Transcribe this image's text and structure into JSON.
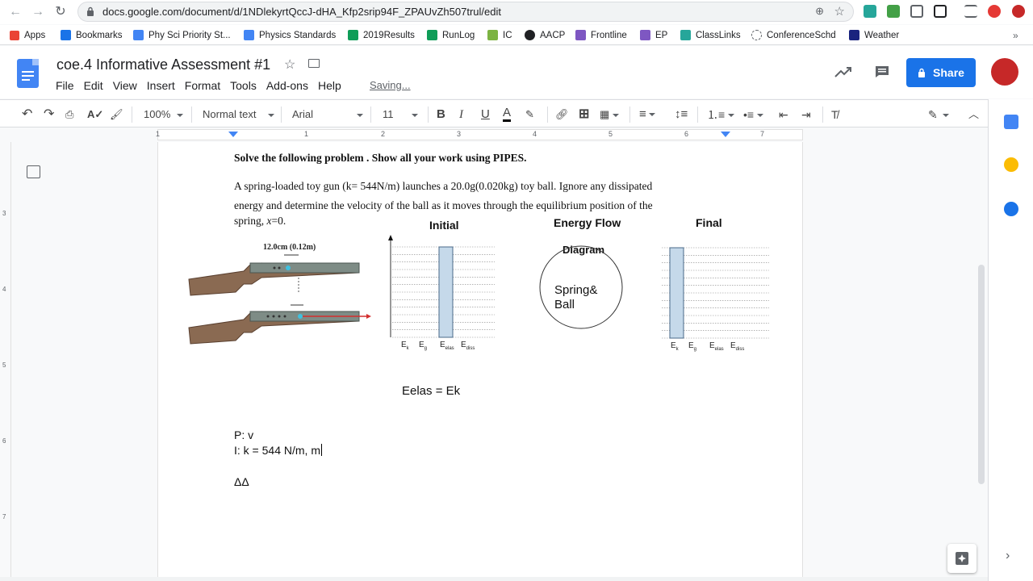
{
  "browser": {
    "url": "docs.google.com/document/d/1NDlekyrtQccJ-dHA_Kfp2srip94F_ZPAUvZh507trul/edit",
    "bookmarks": [
      {
        "label": "Apps",
        "icon": "apps-grid-icon",
        "color": "#ea4335"
      },
      {
        "label": "Bookmarks",
        "icon": "star-icon",
        "color": "#1a73e8"
      },
      {
        "label": "Phy Sci Priority St...",
        "icon": "docs-icon",
        "color": "#4285f4"
      },
      {
        "label": "Physics Standards",
        "icon": "docs-icon",
        "color": "#4285f4"
      },
      {
        "label": "2019Results",
        "icon": "sheets-icon",
        "color": "#0f9d58"
      },
      {
        "label": "RunLog",
        "icon": "sheets-icon",
        "color": "#0f9d58"
      },
      {
        "label": "IC",
        "icon": "ic-icon",
        "color": "#7cb342"
      },
      {
        "label": "AACP",
        "icon": "s-icon",
        "color": "#202124"
      },
      {
        "label": "Frontline",
        "icon": "frontline-icon",
        "color": "#7e57c2"
      },
      {
        "label": "EP",
        "icon": "ep-icon",
        "color": "#7e57c2"
      },
      {
        "label": "ClassLinks",
        "icon": "cloud-icon",
        "color": "#26a69a"
      },
      {
        "label": "ConferenceSchd",
        "icon": "clock-icon",
        "color": "#5f6368"
      },
      {
        "label": "Weather",
        "icon": "weather-icon",
        "color": "#1a237e"
      }
    ]
  },
  "doc": {
    "title": "coe.4 Informative Assessment #1",
    "menu": [
      "File",
      "Edit",
      "View",
      "Insert",
      "Format",
      "Tools",
      "Add-ons",
      "Help"
    ],
    "saving": "Saving...",
    "share": "Share"
  },
  "toolbar": {
    "zoom": "100%",
    "style": "Normal text",
    "font": "Arial",
    "size": "11"
  },
  "ruler": [
    "1",
    "1",
    "2",
    "3",
    "4",
    "5",
    "6",
    "7"
  ],
  "vruler": [
    "3",
    "4",
    "5",
    "6",
    "7"
  ],
  "content": {
    "heading": "Solve the following problem . Show all your work using PIPES.",
    "para1": "A spring-loaded toy gun (k= 544N/m) launches a 20.0g(0.020kg) toy ball.   Ignore any dissipated",
    "para2": "energy and determine the velocity of the ball as it moves through the equilibrium position  of the",
    "para3a": "spring, ",
    "para3b": "x",
    "para3c": "=0.",
    "initial": "Initial",
    "energy_flow": "Energy Flow",
    "diagram": "Diagram",
    "final": "Final",
    "gun_measure": "12.0cm (0.12m)",
    "circle_line1": "Spring&",
    "circle_line2": "Ball",
    "bar_labels": [
      {
        "main": "E",
        "sub": "k"
      },
      {
        "main": "E",
        "sub": "g"
      },
      {
        "main": "E",
        "sub": "elas"
      },
      {
        "main": "E",
        "sub": "diss"
      }
    ],
    "equation": "Eelas = Ek",
    "p_line": "P:  v",
    "i_line": "I:  k = 544 N/m, m",
    "delta": "ΔΔ"
  },
  "chart_data": [
    {
      "type": "bar",
      "title": "Initial",
      "categories": [
        "Ek",
        "Eg",
        "Eelas",
        "Ediss"
      ],
      "values": [
        0,
        0,
        1,
        0
      ],
      "note_scale": "relative bar height only (no numeric axis printed)"
    },
    {
      "type": "bar",
      "title": "Final",
      "categories": [
        "Ek",
        "Eg",
        "Eelas",
        "Ediss"
      ],
      "values": [
        1,
        0,
        0,
        0
      ]
    }
  ],
  "colors": {
    "accent": "#1a73e8",
    "bar_fill": "#c5d9ea",
    "bar_stroke": "#4a6a8a"
  }
}
